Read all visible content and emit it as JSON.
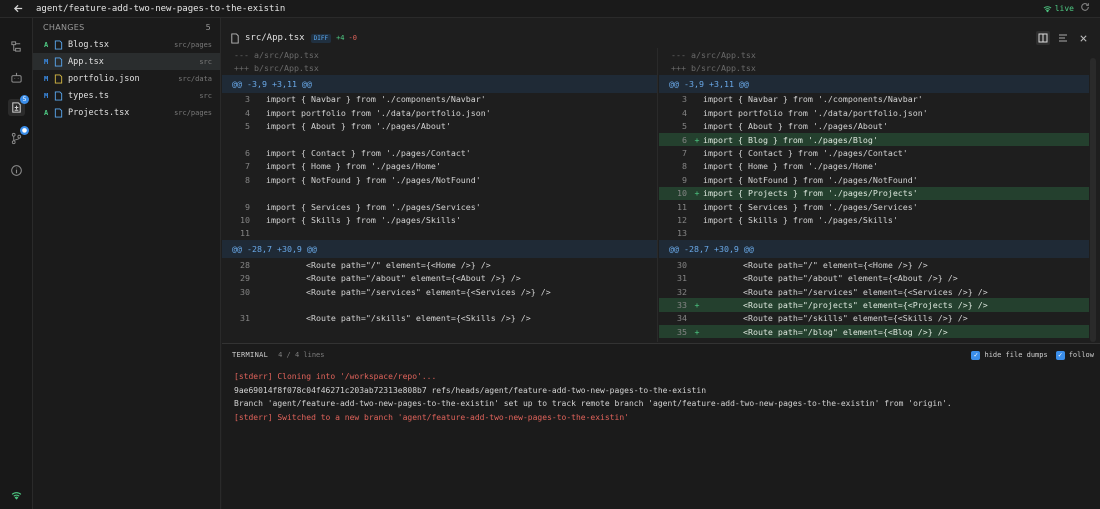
{
  "topbar": {
    "title": "agent/feature-add-two-new-pages-to-the-existin",
    "live_label": "live"
  },
  "activity": {
    "changes_badge": "5",
    "git_badge": "●"
  },
  "changes": {
    "header": "CHANGES",
    "count": "5",
    "files": [
      {
        "status": "A",
        "name": "Blog.tsx",
        "dir": "src/pages",
        "icon": "file-icon"
      },
      {
        "status": "M",
        "name": "App.tsx",
        "dir": "src",
        "icon": "file-icon",
        "selected": true
      },
      {
        "status": "M",
        "name": "portfolio.json",
        "dir": "src/data",
        "icon": "json-icon"
      },
      {
        "status": "M",
        "name": "types.ts",
        "dir": "src",
        "icon": "file-icon"
      },
      {
        "status": "A",
        "name": "Projects.tsx",
        "dir": "src/pages",
        "icon": "file-icon"
      }
    ]
  },
  "diff_header": {
    "path": "src/App.tsx",
    "tag": "DIFF",
    "additions": "+4",
    "deletions": "-0"
  },
  "left_pane": [
    {
      "kind": "hdr",
      "code": "--- a/src/App.tsx"
    },
    {
      "kind": "hdr",
      "code": "+++ b/src/App.tsx"
    },
    {
      "kind": "hunk",
      "code": "@@ -3,9 +3,11 @@"
    },
    {
      "kind": "ctx",
      "ln": "3",
      "code": "import { Navbar } from './components/Navbar'"
    },
    {
      "kind": "ctx",
      "ln": "4",
      "code": "import portfolio from './data/portfolio.json'"
    },
    {
      "kind": "ctx",
      "ln": "5",
      "code": "import { About } from './pages/About'"
    },
    {
      "kind": "blank",
      "code": ""
    },
    {
      "kind": "ctx",
      "ln": "6",
      "code": "import { Contact } from './pages/Contact'"
    },
    {
      "kind": "ctx",
      "ln": "7",
      "code": "import { Home } from './pages/Home'"
    },
    {
      "kind": "ctx",
      "ln": "8",
      "code": "import { NotFound } from './pages/NotFound'"
    },
    {
      "kind": "blank",
      "code": ""
    },
    {
      "kind": "ctx",
      "ln": "9",
      "code": "import { Services } from './pages/Services'"
    },
    {
      "kind": "ctx",
      "ln": "10",
      "code": "import { Skills } from './pages/Skills'"
    },
    {
      "kind": "ctx",
      "ln": "11",
      "code": ""
    },
    {
      "kind": "hunk",
      "code": "@@ -28,7 +30,9 @@"
    },
    {
      "kind": "ctx",
      "ln": "28",
      "code": "        <Route path=\"/\" element={<Home />} />"
    },
    {
      "kind": "ctx",
      "ln": "29",
      "code": "        <Route path=\"/about\" element={<About />} />"
    },
    {
      "kind": "ctx",
      "ln": "30",
      "code": "        <Route path=\"/services\" element={<Services />} />"
    },
    {
      "kind": "blank",
      "code": ""
    },
    {
      "kind": "ctx",
      "ln": "31",
      "code": "        <Route path=\"/skills\" element={<Skills />} />"
    },
    {
      "kind": "blank",
      "code": ""
    }
  ],
  "right_pane": [
    {
      "kind": "hdr",
      "code": "--- a/src/App.tsx"
    },
    {
      "kind": "hdr",
      "code": "+++ b/src/App.tsx"
    },
    {
      "kind": "hunk",
      "code": "@@ -3,9 +3,11 @@"
    },
    {
      "kind": "ctx",
      "ln": "3",
      "code": "import { Navbar } from './components/Navbar'"
    },
    {
      "kind": "ctx",
      "ln": "4",
      "code": "import portfolio from './data/portfolio.json'"
    },
    {
      "kind": "ctx",
      "ln": "5",
      "code": "import { About } from './pages/About'"
    },
    {
      "kind": "added",
      "ln": "6",
      "code": "import { Blog } from './pages/Blog'"
    },
    {
      "kind": "ctx",
      "ln": "7",
      "code": "import { Contact } from './pages/Contact'"
    },
    {
      "kind": "ctx",
      "ln": "8",
      "code": "import { Home } from './pages/Home'"
    },
    {
      "kind": "ctx",
      "ln": "9",
      "code": "import { NotFound } from './pages/NotFound'"
    },
    {
      "kind": "added",
      "ln": "10",
      "code": "import { Projects } from './pages/Projects'"
    },
    {
      "kind": "ctx",
      "ln": "11",
      "code": "import { Services } from './pages/Services'"
    },
    {
      "kind": "ctx",
      "ln": "12",
      "code": "import { Skills } from './pages/Skills'"
    },
    {
      "kind": "ctx",
      "ln": "13",
      "code": ""
    },
    {
      "kind": "hunk",
      "code": "@@ -28,7 +30,9 @@"
    },
    {
      "kind": "ctx",
      "ln": "30",
      "code": "        <Route path=\"/\" element={<Home />} />"
    },
    {
      "kind": "ctx",
      "ln": "31",
      "code": "        <Route path=\"/about\" element={<About />} />"
    },
    {
      "kind": "ctx",
      "ln": "32",
      "code": "        <Route path=\"/services\" element={<Services />} />"
    },
    {
      "kind": "added",
      "ln": "33",
      "code": "        <Route path=\"/projects\" element={<Projects />} />"
    },
    {
      "kind": "ctx",
      "ln": "34",
      "code": "        <Route path=\"/skills\" element={<Skills />} />"
    },
    {
      "kind": "added",
      "ln": "35",
      "code": "        <Route path=\"/blog\" element={<Blog />} />"
    }
  ],
  "terminal": {
    "title": "TERMINAL",
    "count": "4 / 4 lines",
    "hide_dumps_label": "hide file dumps",
    "follow_label": "follow",
    "lines": [
      {
        "kind": "err",
        "text": "[stderr] Cloning into '/workspace/repo'..."
      },
      {
        "kind": "out",
        "text": "9ae69014f8f078c04f46271c203ab72313e808b7    refs/heads/agent/feature-add-two-new-pages-to-the-existin"
      },
      {
        "kind": "out",
        "text": "Branch 'agent/feature-add-two-new-pages-to-the-existin' set up to track remote branch 'agent/feature-add-two-new-pages-to-the-existin' from 'origin'."
      },
      {
        "kind": "err",
        "text": "[stderr] Switched to a new branch 'agent/feature-add-two-new-pages-to-the-existin'"
      }
    ]
  }
}
